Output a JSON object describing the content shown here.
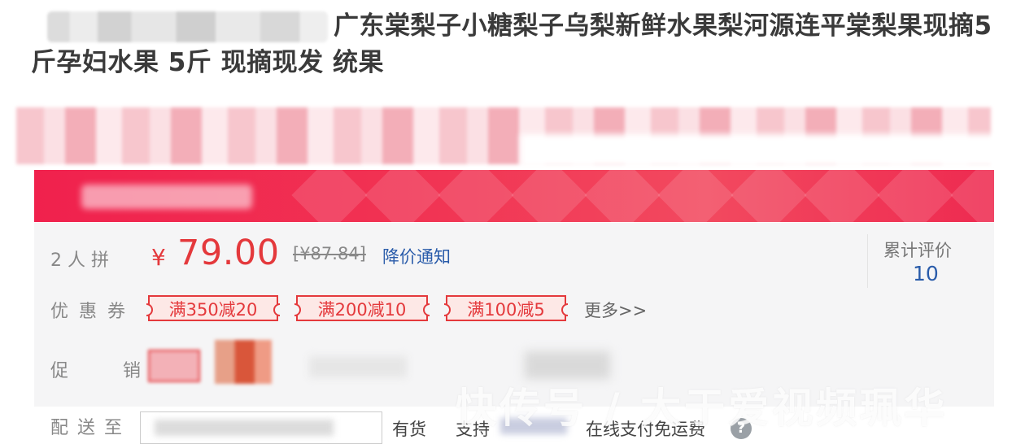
{
  "product": {
    "title": "广东棠梨子小糖梨子乌梨新鲜水果梨河源连平棠梨果现摘5斤孕妇水果 5斤 现摘现发 统果"
  },
  "price_panel": {
    "group_buy_label": "2 人 拼",
    "currency": "¥",
    "price": "79.00",
    "original_price": "[¥87.84]",
    "price_drop_notify": "降价通知",
    "reviews_label": "累计评价",
    "reviews_count": "10"
  },
  "coupons": {
    "label": "优惠券",
    "items": [
      "满350减20",
      "满200减10",
      "满100减5"
    ],
    "more": "更多>>"
  },
  "promotion": {
    "label": "促 销"
  },
  "delivery": {
    "label": "配送至",
    "stock": "有货",
    "support": "支持",
    "payment": "在线支付免运费",
    "help_icon": "?"
  },
  "watermark": {
    "text": "快传号 / 大于爱视频珮华"
  },
  "colors": {
    "accent_red": "#e4393c",
    "banner_red": "#f0214d",
    "link_blue": "#2a5caa"
  }
}
